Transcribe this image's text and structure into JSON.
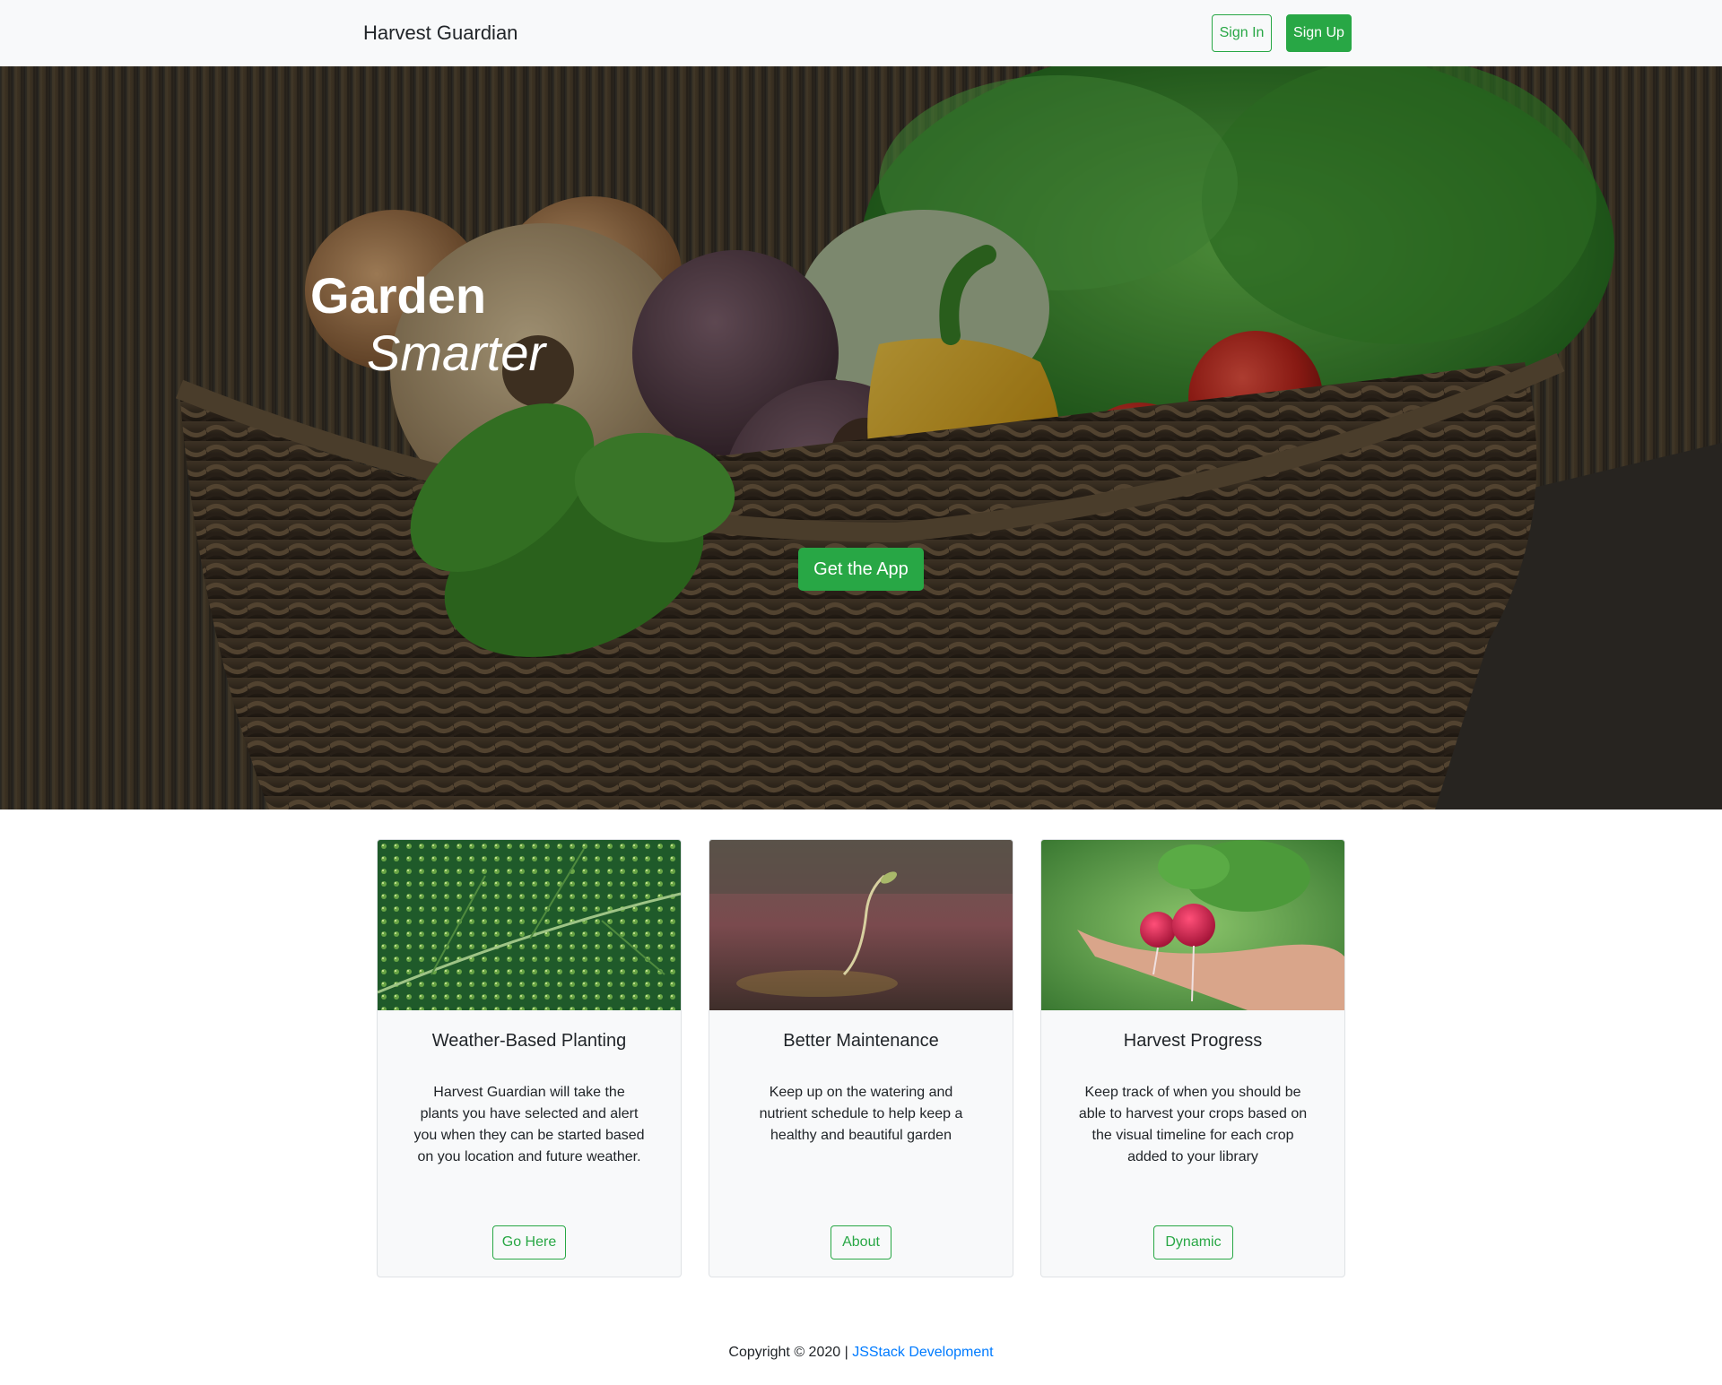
{
  "navbar": {
    "brand": "Harvest Guardian",
    "sign_in_label": "Sign In",
    "sign_up_label": "Sign Up"
  },
  "hero": {
    "title_line1": "Garden",
    "title_line2": "Smarter",
    "cta_label": "Get the App"
  },
  "cards": [
    {
      "title": "Weather-Based Planting",
      "text": "Harvest Guardian will take the plants you have selected and alert you when they can be started based on you location and future weather.",
      "button_label": "Go Here"
    },
    {
      "title": "Better Maintenance",
      "text": "Keep up on the watering and nutrient schedule to help keep a healthy and beautiful garden",
      "button_label": "About"
    },
    {
      "title": "Harvest Progress",
      "text": "Keep track of when you should be able to harvest your crops based on the visual timeline for each crop added to your library",
      "button_label": "Dynamic"
    }
  ],
  "footer": {
    "copyright": "Copyright © 2020 | ",
    "link_text": "JSStack Development"
  },
  "colors": {
    "accent": "#28a745",
    "link": "#007bff",
    "navbar_bg": "#f8f9fa",
    "card_bg": "#f8f9fa"
  }
}
